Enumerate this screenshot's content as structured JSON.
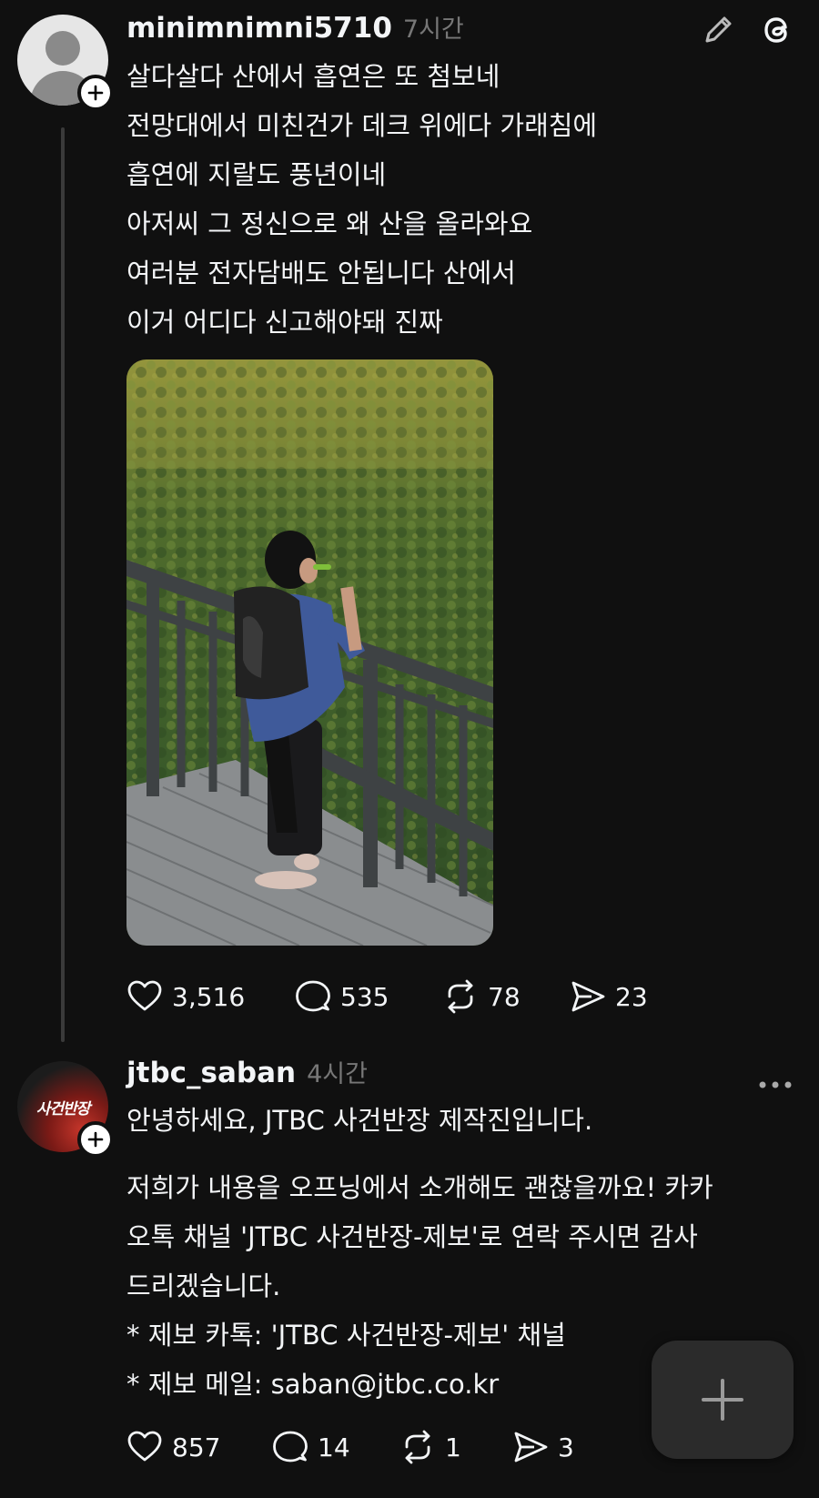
{
  "post1": {
    "username": "minimnimni5710",
    "time": "7시간",
    "lines": [
      "살다살다 산에서 흡연은 또 첨보네",
      "전망대에서 미친건가 데크 위에다 가래침에",
      "흡연에 지랄도 풍년이네",
      "아저씨 그 정신으로 왜 산을 올라와요",
      "여러분 전자담배도 안됩니다 산에서",
      "이거 어디다 신고해야돼 진짜"
    ],
    "likes": "3,516",
    "comments": "535",
    "reposts": "78",
    "shares": "23"
  },
  "post2": {
    "username": "jtbc_saban",
    "time": "4시간",
    "avatar_text": "사건반장",
    "paragraph1": "안녕하세요, JTBC 사건반장 제작진입니다.",
    "paragraph2_lines": [
      "저희가 내용을 오프닝에서 소개해도 괜찮을까요! 카카",
      "오톡 채널 'JTBC 사건반장-제보'로 연락 주시면 감사",
      "드리겠습니다."
    ],
    "paragraph3_lines": [
      "* 제보 카톡: 'JTBC 사건반장-제보' 채널",
      "* 제보 메일: saban@jtbc.co.kr"
    ],
    "likes": "857",
    "comments": "14",
    "reposts": "1",
    "shares": "3"
  },
  "icons": {
    "edit": "pencil-icon",
    "threads": "threads-logo-icon",
    "more": "more-dots-icon",
    "like": "heart-icon",
    "comment": "comment-bubble-icon",
    "repost": "repost-icon",
    "share": "send-icon",
    "compose": "plus-icon"
  }
}
